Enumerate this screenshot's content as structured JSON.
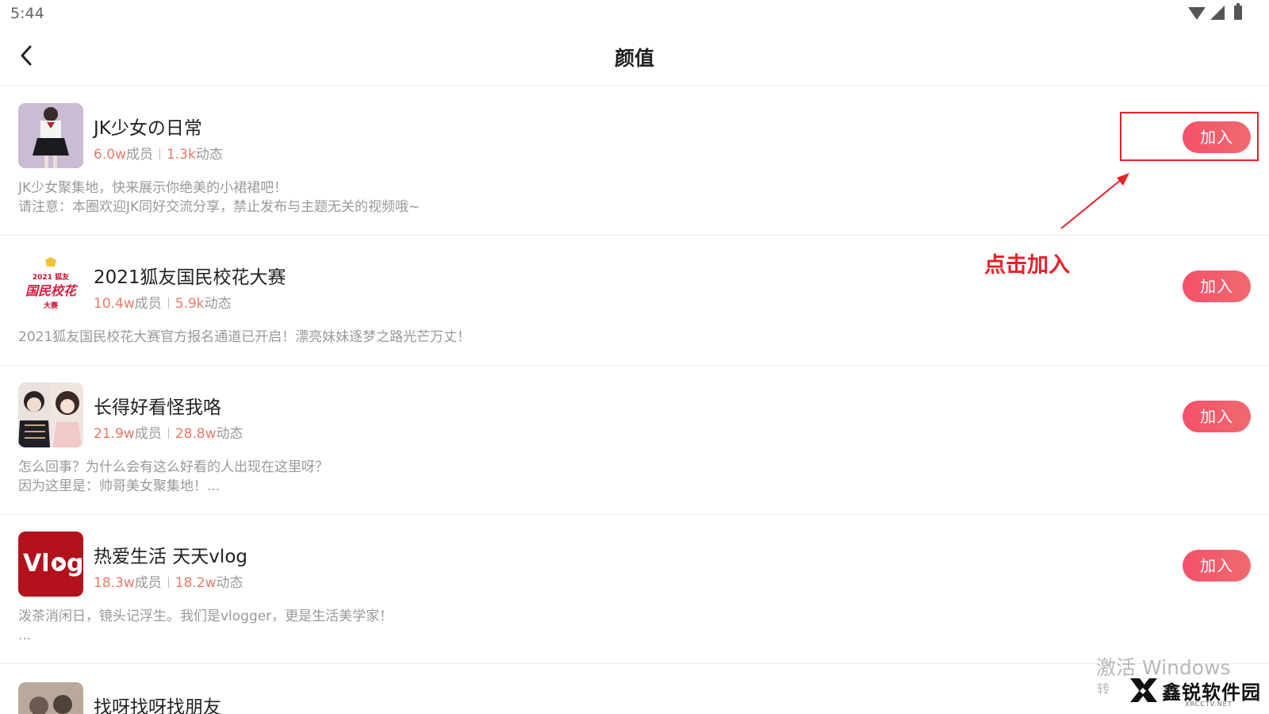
{
  "status_bar": {
    "time": "5:44"
  },
  "header": {
    "title": "颜值"
  },
  "groups": [
    {
      "name": "JK少女の日常",
      "members": "6.0w",
      "members_unit": "成员",
      "posts": "1.3k",
      "posts_unit": "动态",
      "desc_line1": "JK少女聚集地，快来展示你绝美的小裙裙吧！",
      "desc_line2": "请注意：本圈欢迎JK同好交流分享，禁止发布与主题无关的视频哦~",
      "join_label": "加入"
    },
    {
      "name": "2021狐友国民校花大赛",
      "members": "10.4w",
      "members_unit": "成员",
      "posts": "5.9k",
      "posts_unit": "动态",
      "desc_line1": "2021狐友国民校花大赛官方报名通道已开启！漂亮妹妹逐梦之路光芒万丈！",
      "desc_line2": "",
      "join_label": "加入",
      "logo_line1": "2021 狐友",
      "logo_line2": "国民校花",
      "logo_line3": "大赛"
    },
    {
      "name": "长得好看怪我咯",
      "members": "21.9w",
      "members_unit": "成员",
      "posts": "28.8w",
      "posts_unit": "动态",
      "desc_line1": "怎么回事？为什么会有这么好看的人出现在这里呀？",
      "desc_line2": "因为这里是：帅哥美女聚集地！...",
      "join_label": "加入"
    },
    {
      "name": "热爱生活 天天vlog",
      "members": "18.3w",
      "members_unit": "成员",
      "posts": "18.2w",
      "posts_unit": "动态",
      "desc_line1": "泼茶消闲日，镜头记浮生。我们是vlogger，更是生活美学家！",
      "desc_line2": "...",
      "join_label": "加入",
      "logo_text_a": "Vl",
      "logo_text_b": "g"
    },
    {
      "name": "找呀找呀找朋友"
    }
  ],
  "annotation": {
    "label": "点击加入",
    "color": "#e8202a"
  },
  "watermark": {
    "activate": "激活 Windows",
    "sub": "转",
    "brand": "鑫锐软件园",
    "brand_sub": "XRCCTV.NET"
  },
  "colors": {
    "accent": "#f5506a",
    "stat": "#e87b64",
    "muted": "#999999"
  }
}
